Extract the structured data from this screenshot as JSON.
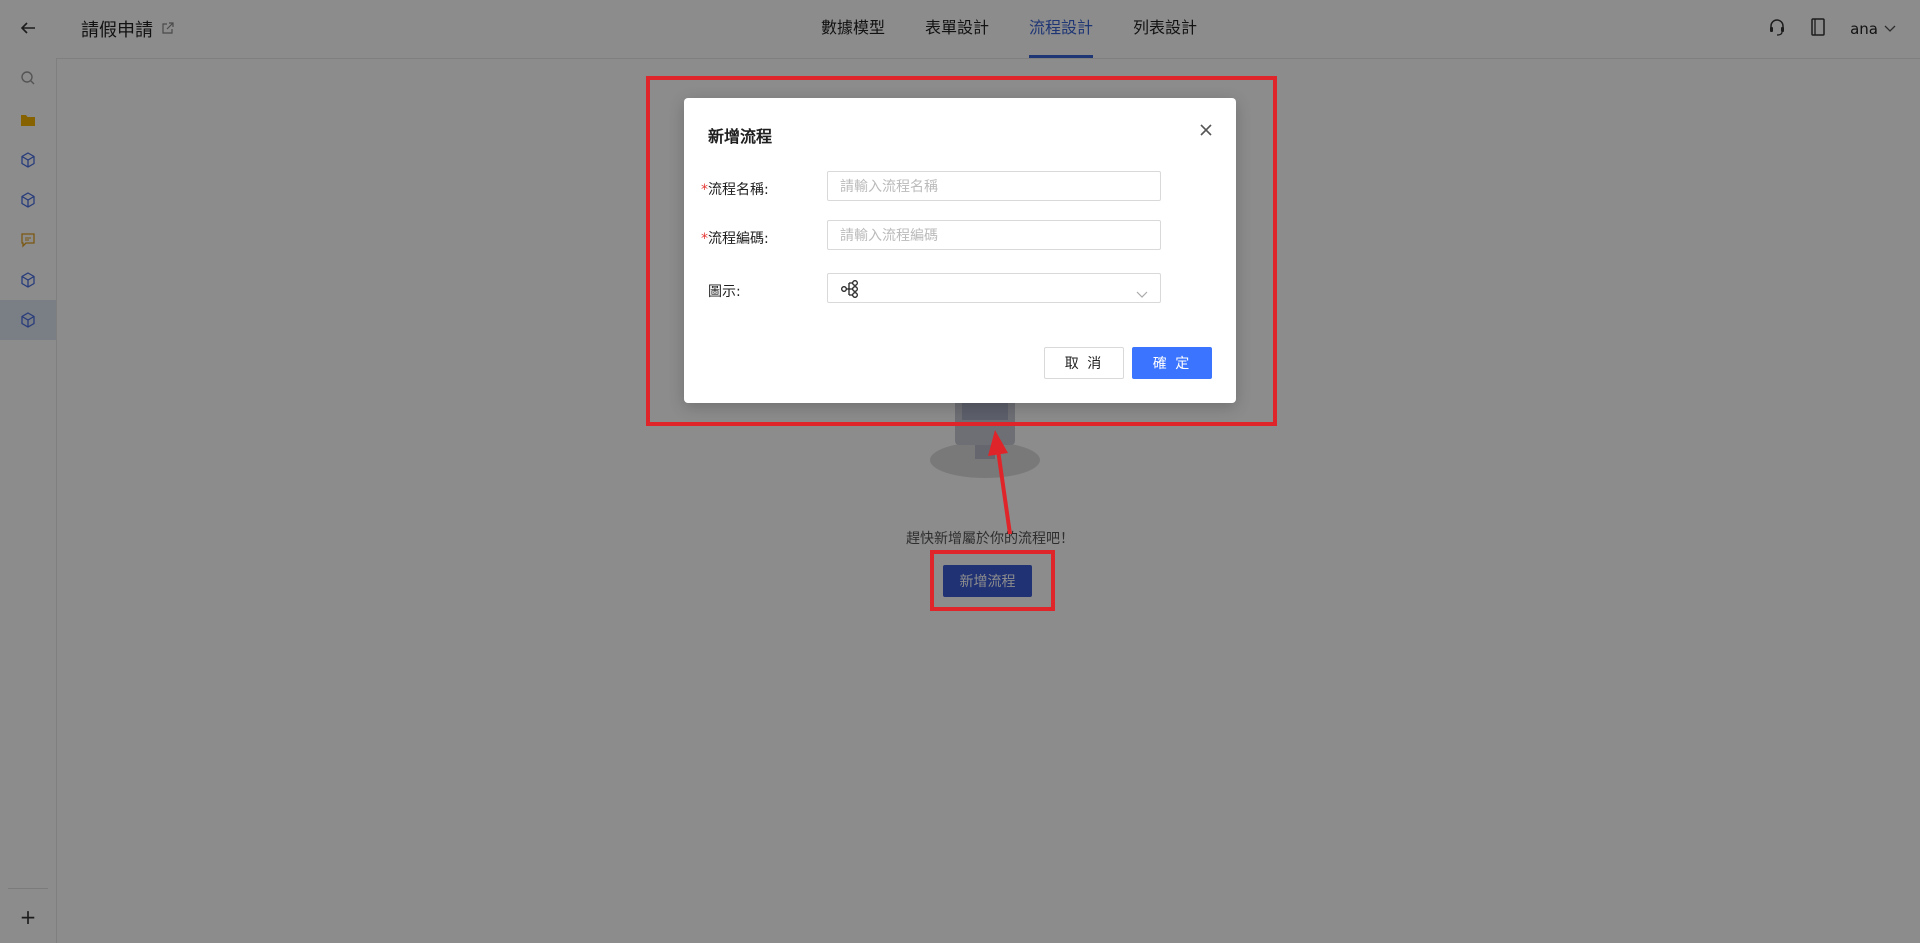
{
  "header": {
    "title": "請假申請",
    "tabs": [
      {
        "label": "數據模型",
        "active": false
      },
      {
        "label": "表單設計",
        "active": false
      },
      {
        "label": "流程設計",
        "active": true
      },
      {
        "label": "列表設計",
        "active": false
      }
    ],
    "user": "ana"
  },
  "sidebar": {
    "icons": [
      "back-arrow-icon",
      "search-icon",
      "folder-icon",
      "cube-icon",
      "cube-icon",
      "comment-icon",
      "cube-icon",
      "cube-icon"
    ],
    "add_label": "+"
  },
  "empty_state": {
    "text": "趕快新增屬於你的流程吧！",
    "button": "新增流程"
  },
  "modal": {
    "title": "新增流程",
    "fields": [
      {
        "label": "流程名稱:",
        "required": true,
        "placeholder": "請輸入流程名稱",
        "value": ""
      },
      {
        "label": "流程編碼:",
        "required": true,
        "placeholder": "請輸入流程編碼",
        "value": ""
      },
      {
        "label": "圖示:",
        "required": false,
        "selected_icon": "flow-icon"
      }
    ],
    "cancel": "取 消",
    "confirm": "確 定"
  },
  "colors": {
    "accent": "#3a63d6",
    "primary_button": "#3b74ff",
    "annotation": "#e0252a"
  }
}
